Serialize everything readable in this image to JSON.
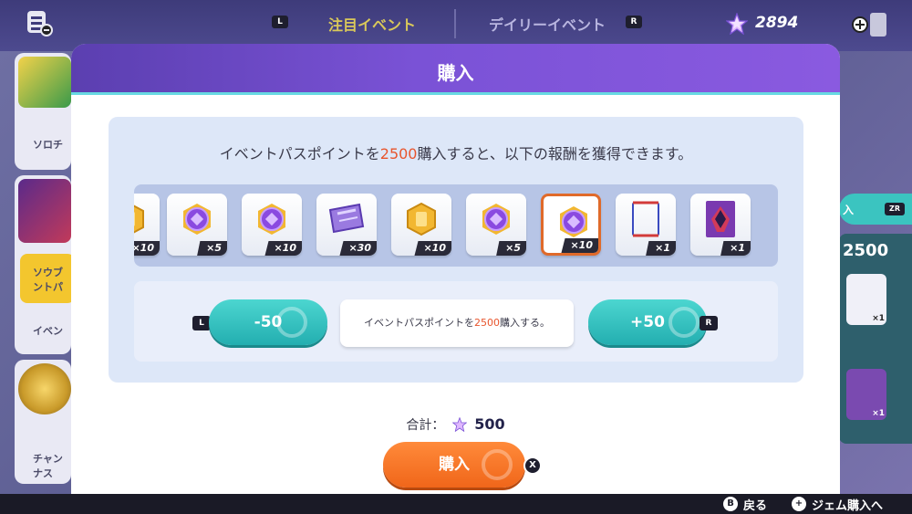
{
  "header": {
    "tabs": [
      {
        "key": "L",
        "label": "注目イベント",
        "active": true
      },
      {
        "key": "R",
        "label": "デイリーイベント",
        "active": false
      }
    ],
    "gems": "2894"
  },
  "sidebar": {
    "cards": [
      {
        "label": "ソロチ"
      },
      {
        "label": "ソウブ\nントパ"
      },
      {
        "label": "イベン"
      },
      {
        "label": "チャン\nナス"
      }
    ]
  },
  "right": {
    "chip_label": "入",
    "chip_key": "ZR",
    "points": "2500",
    "card_qty_1": "×1",
    "card_qty_2": "×1"
  },
  "modal": {
    "title": "購入",
    "info_prefix": "イベントパスポイントを",
    "info_amount": "2500",
    "info_suffix": "購入すると、以下の報酬を獲得できます。",
    "rewards": [
      {
        "icon": "gold-coin-icon",
        "qty": "×10"
      },
      {
        "icon": "purple-coin-icon",
        "qty": "×5"
      },
      {
        "icon": "purple-coin-icon",
        "qty": "×10"
      },
      {
        "icon": "ticket-icon",
        "qty": "×30"
      },
      {
        "icon": "gold-coin-icon",
        "qty": "×10"
      },
      {
        "icon": "purple-coin-icon",
        "qty": "×5"
      },
      {
        "icon": "purple-coin-icon",
        "qty": "×10",
        "selected": true
      },
      {
        "icon": "frame-icon",
        "qty": "×1"
      },
      {
        "icon": "portrait-card-icon",
        "qty": "×1"
      }
    ],
    "minus_label": "-50",
    "minus_key": "L",
    "plus_label": "+50",
    "plus_key": "R",
    "stepper_msg_prefix": "イベントパスポイントを",
    "stepper_msg_amount": "2500",
    "stepper_msg_suffix": "購入する。",
    "total_label": "合計：",
    "total_amount": "500",
    "buy_label": "購入",
    "buy_key": "X"
  },
  "bottom": {
    "back_key": "B",
    "back_label": "戻る",
    "gem_shop_label": "ジェム購入へ"
  },
  "colors": {
    "header_purple": "#7a52d6",
    "accent_teal": "#23aeb0",
    "accent_orange": "#f0661a",
    "highlight_text": "#e8552d"
  }
}
